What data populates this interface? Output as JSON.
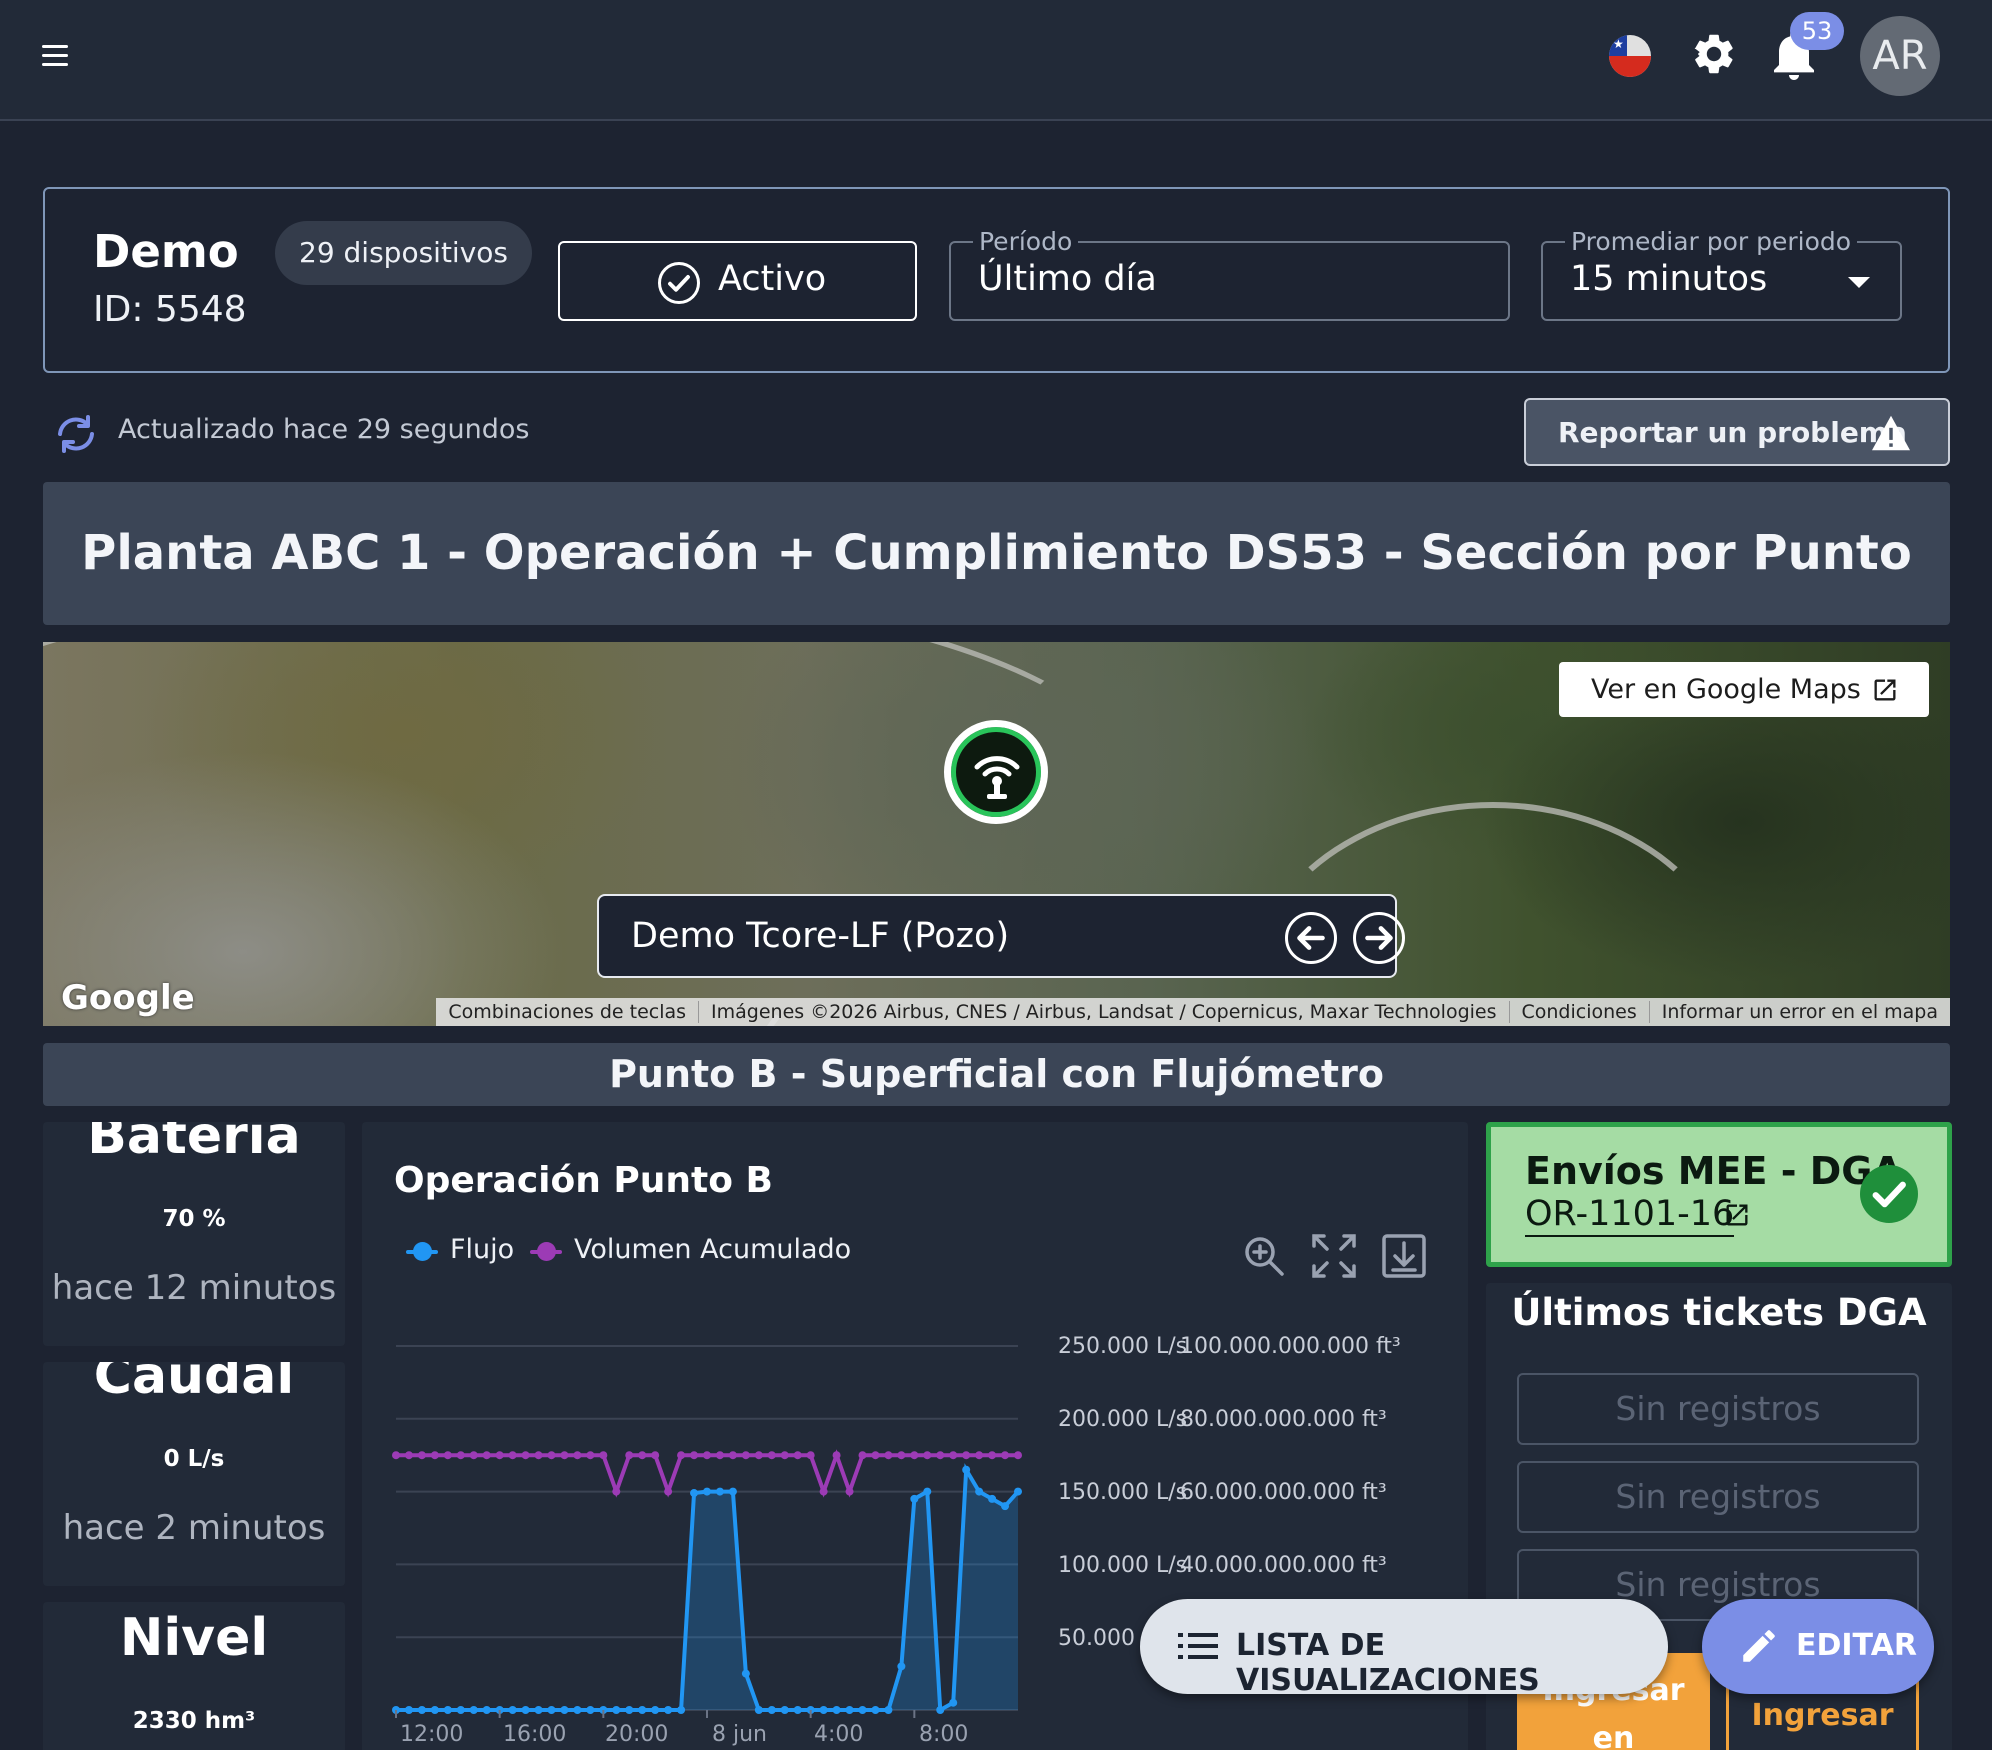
{
  "topbar": {
    "notification_count": "53",
    "avatar_initials": "AR",
    "country": "Chile"
  },
  "header": {
    "title": "Demo",
    "id_label": "ID: 5548",
    "devices_chip": "29 dispositivos",
    "status_label": "Activo",
    "period_label": "Período",
    "period_value": "Último día",
    "average_label": "Promediar por periodo",
    "average_value": "15 minutos"
  },
  "status_row": {
    "updated_text": "Actualizado hace 29 segundos",
    "report_button": "Reportar un problema"
  },
  "dashboard_title": "Planta ABC 1 - Operación + Cumplimiento DS53 - Sección por Punto",
  "map": {
    "google_maps_button": "Ver en Google Maps",
    "device_name": "Demo Tcore-LF (Pozo)",
    "logo": "Google",
    "attribution": [
      "Combinaciones de teclas",
      "Imágenes ©2026 Airbus, CNES / Airbus, Landsat / Copernicus, Maxar Technologies",
      "Condiciones",
      "Informar un error en el mapa"
    ]
  },
  "section_title": "Punto B - Superficial con Flujómetro",
  "metrics": [
    {
      "title": "Batería",
      "value": "70 %",
      "time": "hace 12 minutos"
    },
    {
      "title": "Caudal",
      "value": "0 L/s",
      "time": "hace 2 minutos"
    },
    {
      "title": "Nivel",
      "value": "2330 hm³",
      "time": ""
    }
  ],
  "chart": {
    "title": "Operación Punto B",
    "legend": [
      "Flujo",
      "Volumen Acumulado"
    ],
    "colors": {
      "flujo": "#2196f3",
      "volumen": "#9c3bb5"
    },
    "y_left_ticks": [
      "250.000 L/s",
      "200.000 L/s",
      "150.000 L/s",
      "100.000 L/s",
      "50.000 L/s"
    ],
    "y_right_ticks": [
      "100.000.000.000 ft³",
      "80.000.000.000 ft³",
      "60.000.000.000 ft³",
      "40.000.000.000 ft³",
      ""
    ],
    "x_ticks": [
      "12:00",
      "16:00",
      "20:00",
      "8 jun",
      "4:00",
      "8:00"
    ]
  },
  "chart_data": {
    "type": "line",
    "title": "Operación Punto B",
    "x": [
      "12:00",
      "12:30",
      "13:00",
      "13:30",
      "14:00",
      "14:30",
      "15:00",
      "15:30",
      "16:00",
      "16:30",
      "17:00",
      "17:30",
      "18:00",
      "18:30",
      "19:00",
      "19:30",
      "20:00",
      "20:30",
      "21:00",
      "21:30",
      "22:00",
      "22:30",
      "23:00",
      "23:30",
      "8 jun 00:00",
      "00:30",
      "01:00",
      "01:30",
      "02:00",
      "02:30",
      "03:00",
      "03:30",
      "04:00",
      "04:30",
      "05:00",
      "05:30",
      "06:00",
      "06:30",
      "07:00",
      "07:30",
      "08:00",
      "08:30",
      "09:00",
      "09:30",
      "10:00",
      "10:30",
      "11:00",
      "11:30",
      "12:00"
    ],
    "series": [
      {
        "name": "Flujo",
        "unit": "L/s",
        "axis": "left",
        "values": [
          0,
          0,
          0,
          0,
          0,
          0,
          0,
          0,
          0,
          0,
          0,
          0,
          0,
          0,
          0,
          0,
          0,
          0,
          0,
          0,
          0,
          0,
          0,
          149000,
          150000,
          150000,
          150000,
          25000,
          0,
          0,
          0,
          0,
          0,
          0,
          0,
          0,
          0,
          0,
          0,
          30000,
          145000,
          150000,
          0,
          5000,
          165000,
          150000,
          145000,
          140000,
          150000
        ]
      },
      {
        "name": "Volumen Acumulado",
        "unit": "ft³",
        "axis": "right",
        "values": [
          70000000000,
          70000000000,
          70000000000,
          70000000000,
          70000000000,
          70000000000,
          70000000000,
          70000000000,
          70000000000,
          70000000000,
          70000000000,
          70000000000,
          70000000000,
          70000000000,
          70000000000,
          70000000000,
          70000000000,
          60000000000,
          70000000000,
          70000000000,
          70000000000,
          60000000000,
          70000000000,
          70000000000,
          70000000000,
          70000000000,
          70000000000,
          70000000000,
          70000000000,
          70000000000,
          70000000000,
          70000000000,
          70000000000,
          60000000000,
          70000000000,
          60000000000,
          70000000000,
          70000000000,
          70000000000,
          70000000000,
          70000000000,
          70000000000,
          70000000000,
          70000000000,
          70000000000,
          70000000000,
          70000000000,
          70000000000,
          70000000000
        ]
      }
    ],
    "ylim_left": [
      0,
      250000
    ],
    "ylim_right": [
      0,
      100000000000
    ],
    "grid": true,
    "legend_position": "top-left"
  },
  "dga": {
    "title": "Envíos MEE - DGA",
    "code": "OR-1101-16",
    "tickets_title": "Últimos tickets DGA",
    "empty_rows": [
      "Sin registros",
      "Sin registros",
      "Sin registros"
    ],
    "ingresar_primary": "Ingresar en",
    "ingresar_secondary": "Ingresar"
  },
  "fabs": {
    "list_label": "LISTA DE VISUALIZACIONES",
    "edit_label": "EDITAR"
  }
}
